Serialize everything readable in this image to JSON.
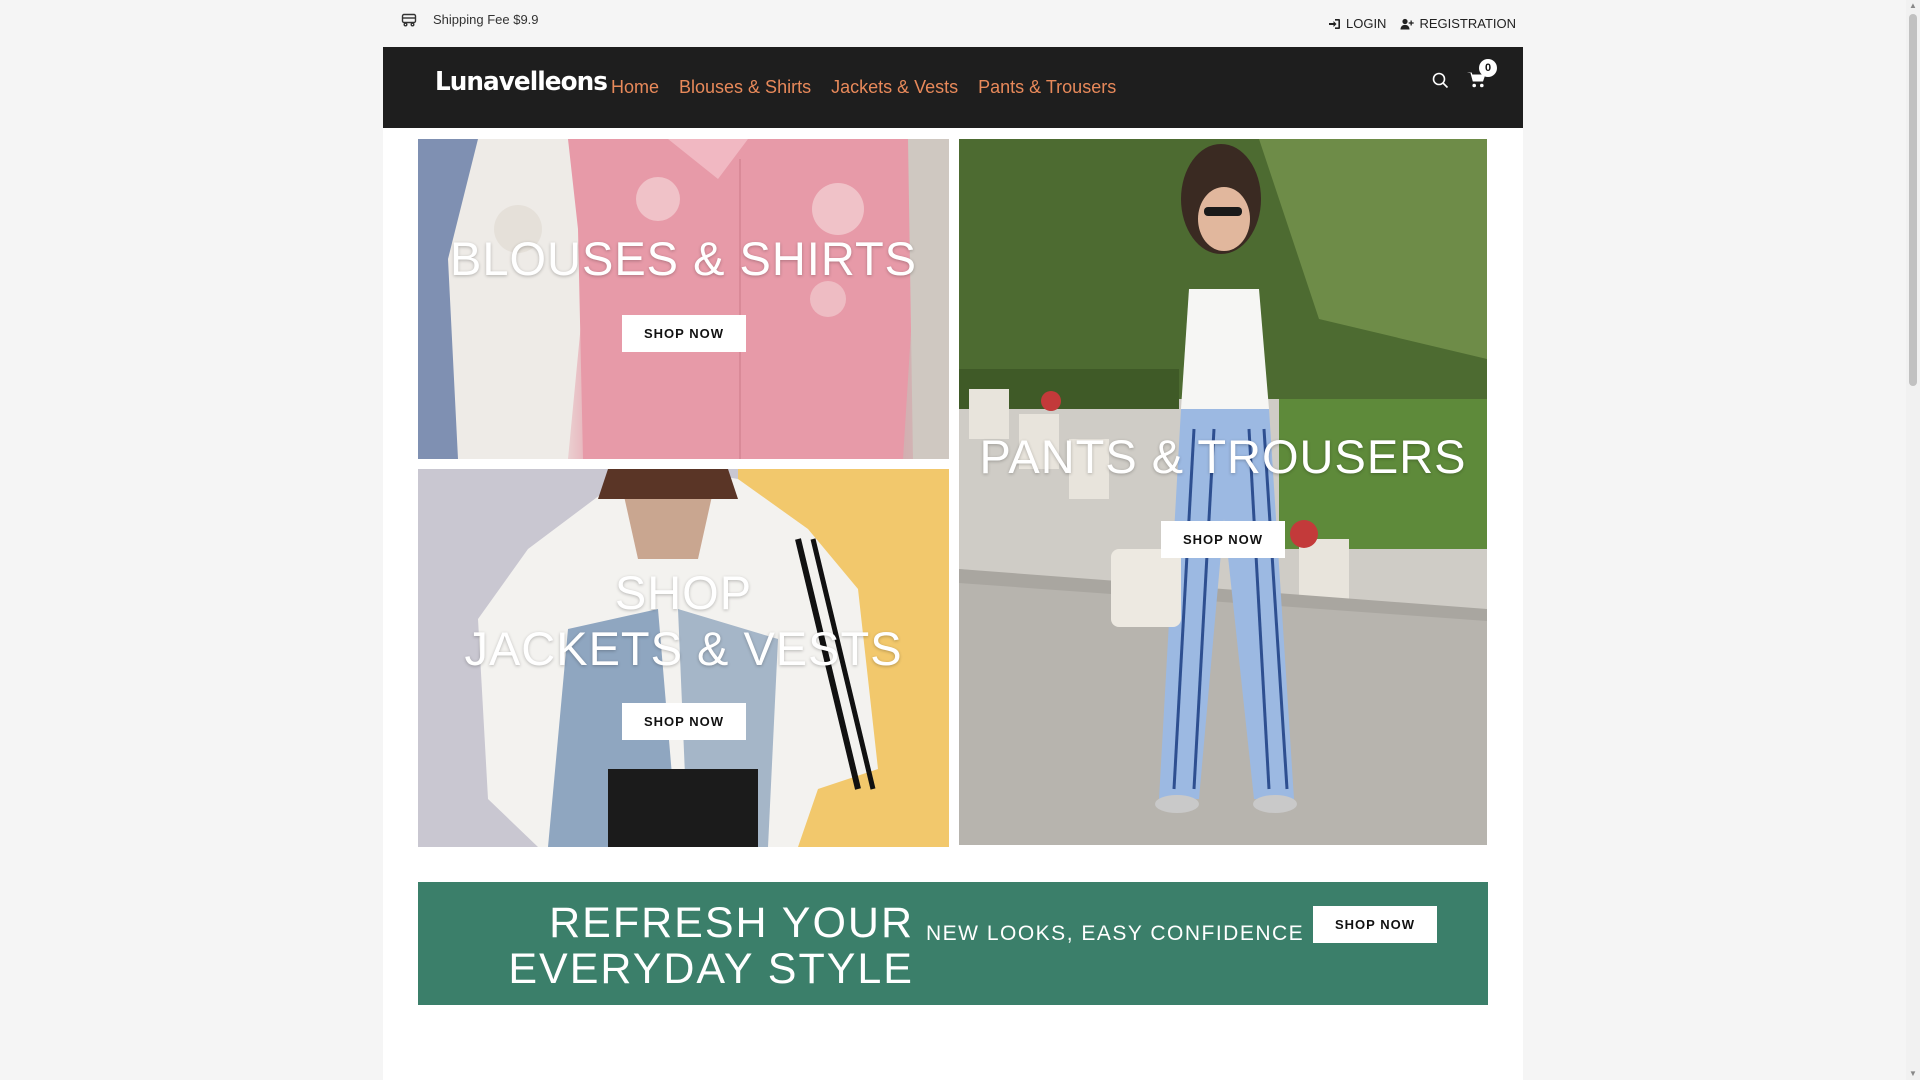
{
  "topbar": {
    "shipping_text": "Shipping Fee $9.9",
    "login_label": "LOGIN",
    "registration_label": "REGISTRATION"
  },
  "header": {
    "logo_text": "Lunavelleons",
    "nav": [
      {
        "label": "Home"
      },
      {
        "label": "Blouses & Shirts"
      },
      {
        "label": "Jackets & Vests"
      },
      {
        "label": "Pants & Trousers"
      }
    ],
    "cart_count": "0",
    "icons": {
      "search": "search-icon",
      "cart": "cart-icon",
      "shipping": "truck-icon",
      "login": "login-icon",
      "registration": "user-plus-icon"
    }
  },
  "tiles": {
    "blouses": {
      "title": "BLOUSES & SHIRTS",
      "button": "SHOP NOW"
    },
    "jackets": {
      "title_line1": "SHOP",
      "title_line2": "JACKETS & VESTS",
      "button": "SHOP NOW"
    },
    "pants": {
      "title": "PANTS & TROUSERS",
      "button": "SHOP NOW"
    }
  },
  "banner": {
    "headline_line1": "REFRESH YOUR",
    "headline_line2": "EVERYDAY STYLE",
    "subtitle": "NEW LOOKS, EASY CONFIDENCE",
    "button": "SHOP NOW",
    "color": "#3b7f6a"
  },
  "colors": {
    "nav_link": "#e8895a",
    "header_bg": "#1e1e1e"
  }
}
